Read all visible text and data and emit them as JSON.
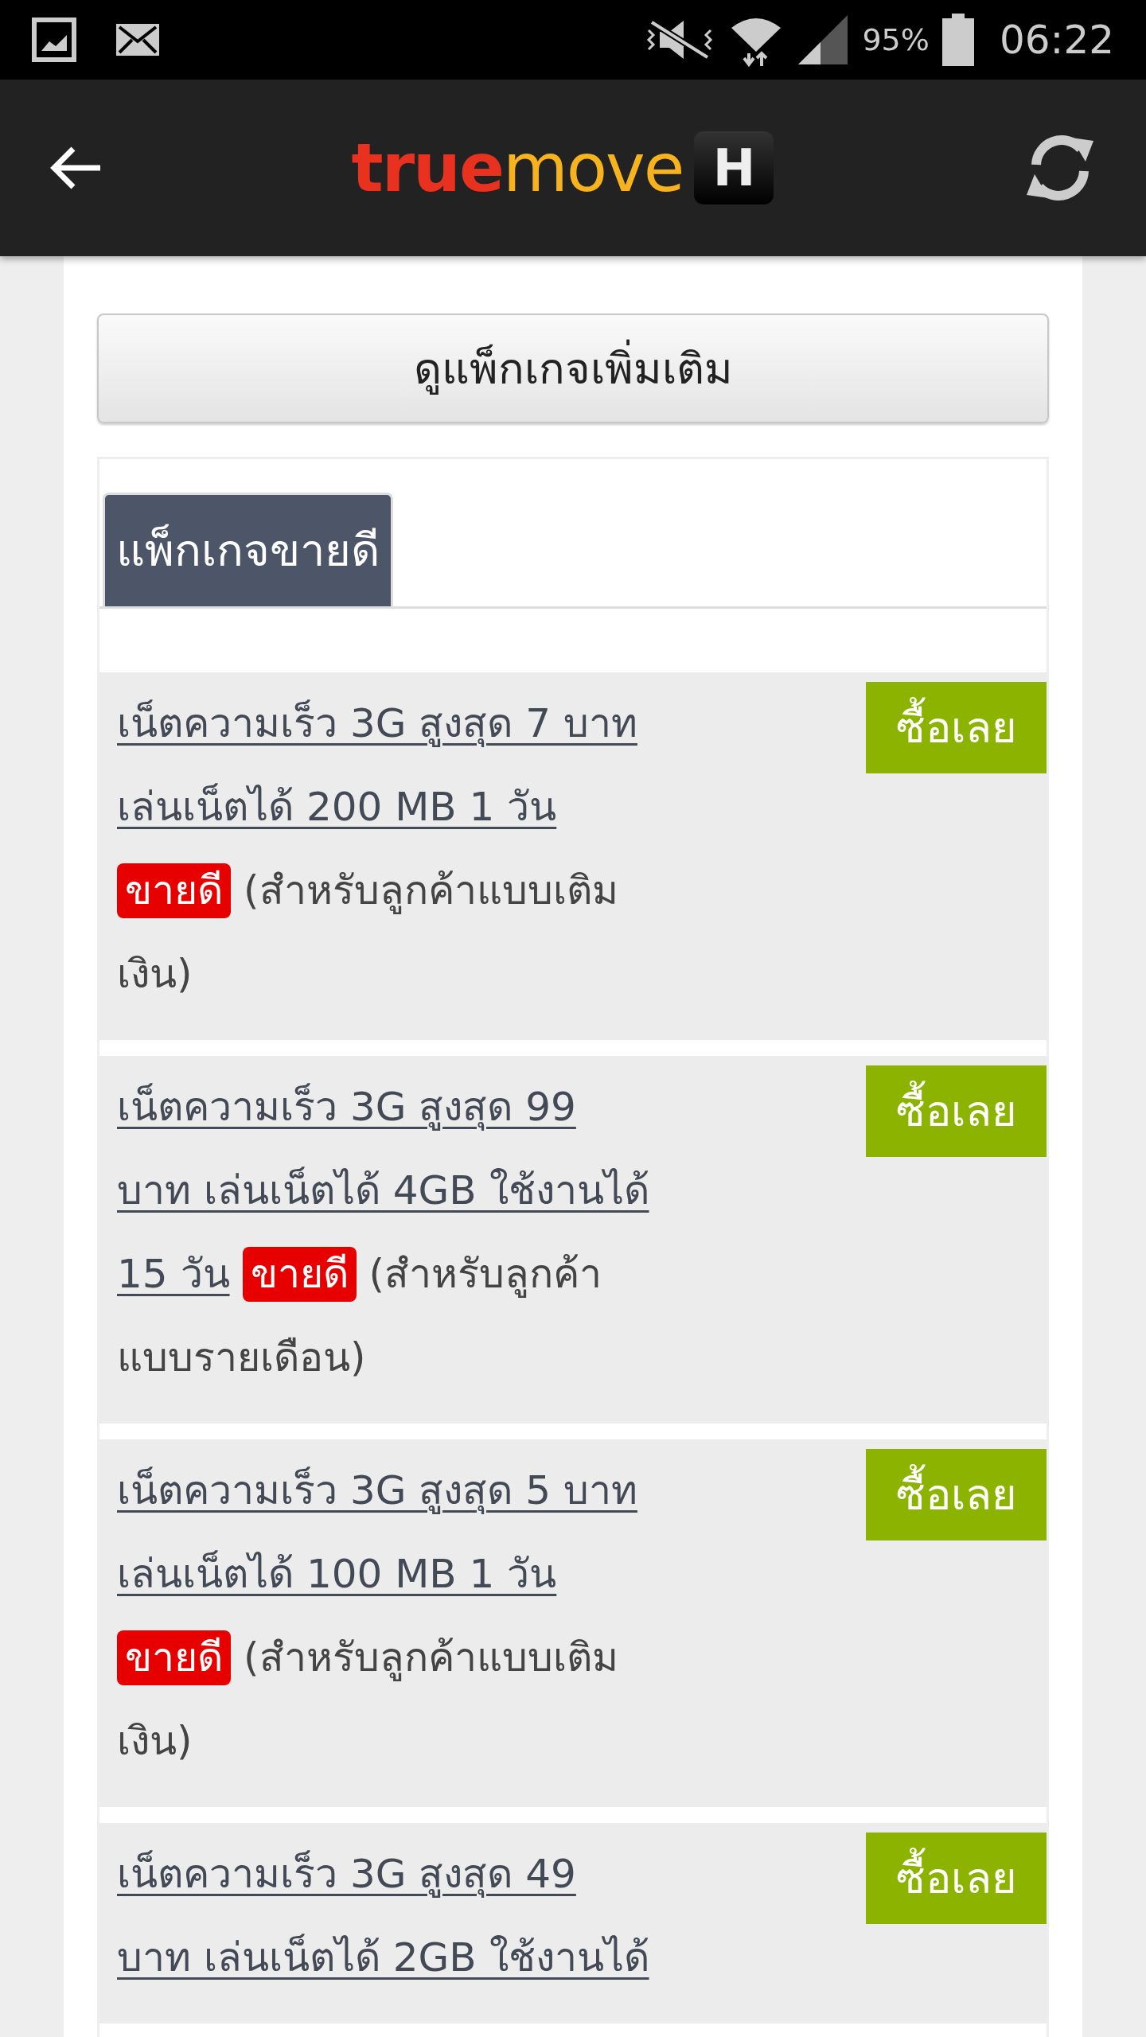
{
  "status_bar": {
    "battery": "95%",
    "time": "06:22"
  },
  "app_bar": {
    "logo": {
      "part_1": "true",
      "part_2": "move",
      "badge": "H"
    }
  },
  "more_button": "ดูแพ็กเกจเพิ่มเติม",
  "tabs": [
    {
      "label": "แพ็กเกจขายดี",
      "selected": true
    }
  ],
  "packages": [
    {
      "lines": [
        [
          {
            "kind": "link",
            "text": "เน็ตความเร็ว 3G สูงสุด 7 บาท"
          }
        ],
        [
          {
            "kind": "link",
            "text": "เล่นเน็ตได้ 200 MB 1 วัน"
          }
        ],
        [
          {
            "kind": "tag",
            "text": "ขายดี"
          },
          {
            "kind": "note",
            "text": "(สำหรับลูกค้าแบบเติม"
          }
        ],
        [
          {
            "kind": "note",
            "text": "เงิน)"
          }
        ]
      ],
      "buy_button": "ซื้อเลย"
    },
    {
      "lines": [
        [
          {
            "kind": "link",
            "text": "เน็ตความเร็ว 3G สูงสุด 99"
          }
        ],
        [
          {
            "kind": "link",
            "text": "บาท เล่นเน็ตได้ 4GB ใช้งานได้"
          }
        ],
        [
          {
            "kind": "link",
            "text": "15 วัน"
          },
          {
            "kind": "tag",
            "text": "ขายดี"
          },
          {
            "kind": "note",
            "text": "(สำหรับลูกค้า"
          }
        ],
        [
          {
            "kind": "note",
            "text": "แบบรายเดือน)"
          }
        ]
      ],
      "buy_button": "ซื้อเลย"
    },
    {
      "lines": [
        [
          {
            "kind": "link",
            "text": "เน็ตความเร็ว 3G สูงสุด 5 บาท"
          }
        ],
        [
          {
            "kind": "link",
            "text": "เล่นเน็ตได้ 100 MB 1 วัน"
          }
        ],
        [
          {
            "kind": "tag",
            "text": "ขายดี"
          },
          {
            "kind": "note",
            "text": "(สำหรับลูกค้าแบบเติม"
          }
        ],
        [
          {
            "kind": "note",
            "text": "เงิน)"
          }
        ]
      ],
      "buy_button": "ซื้อเลย"
    },
    {
      "lines": [
        [
          {
            "kind": "link",
            "text": "เน็ตความเร็ว 3G สูงสุด 49"
          }
        ],
        [
          {
            "kind": "link",
            "text": "บาท เล่นเน็ตได้ 2GB ใช้งานได้"
          }
        ]
      ],
      "buy_button": "ซื้อเลย"
    }
  ]
}
